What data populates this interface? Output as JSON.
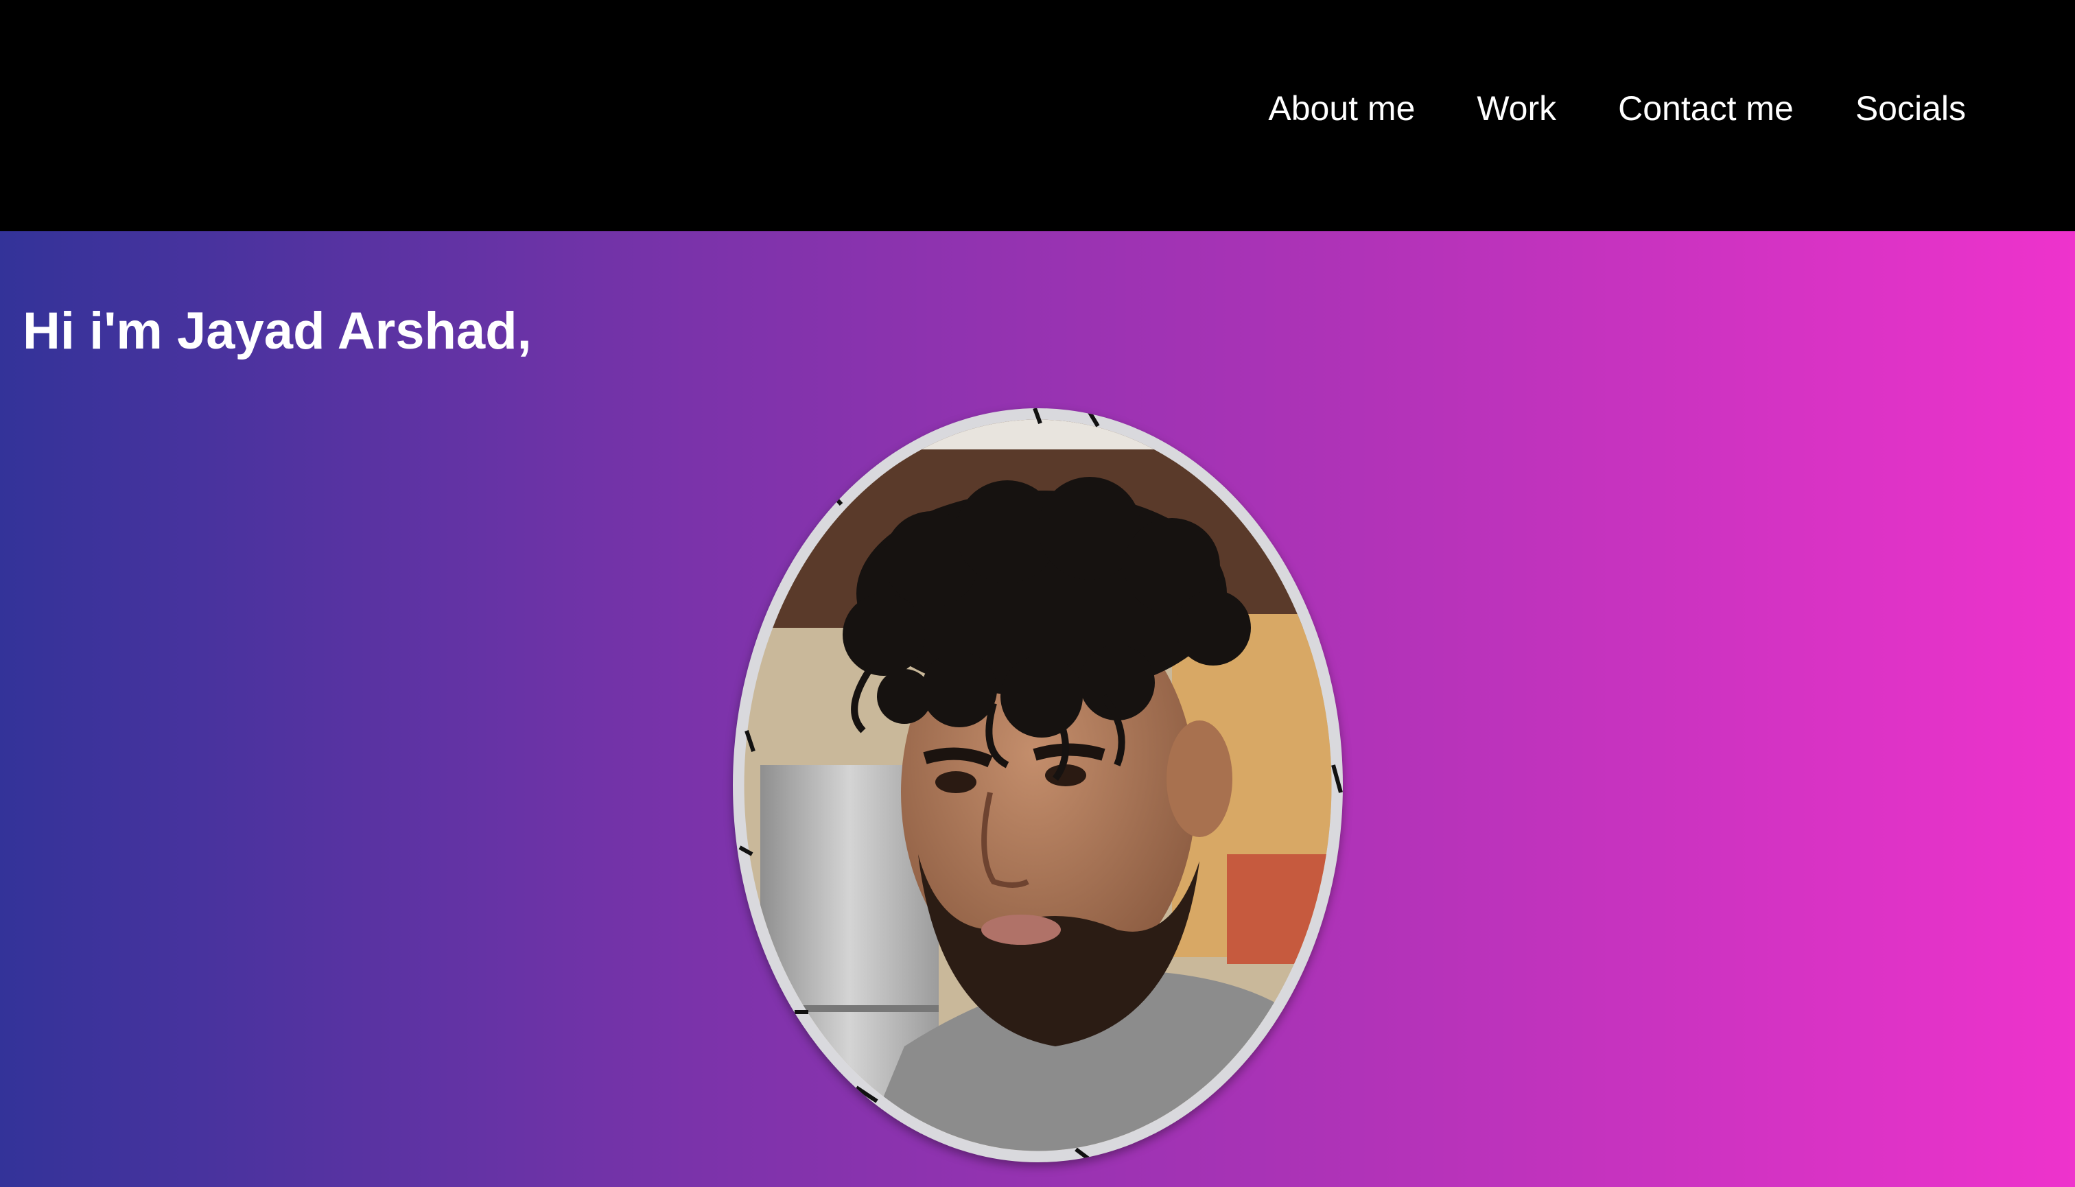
{
  "nav": {
    "items": [
      {
        "label": "About me"
      },
      {
        "label": "Work"
      },
      {
        "label": "Contact me"
      },
      {
        "label": "Socials"
      }
    ]
  },
  "hero": {
    "greeting": "Hi i'm Jayad Arshad,",
    "gradient_start": "#333399",
    "gradient_end": "#ee33cc"
  },
  "colors": {
    "nav_background": "#000000",
    "nav_text": "#ffffff",
    "hero_text": "#ffffff"
  }
}
